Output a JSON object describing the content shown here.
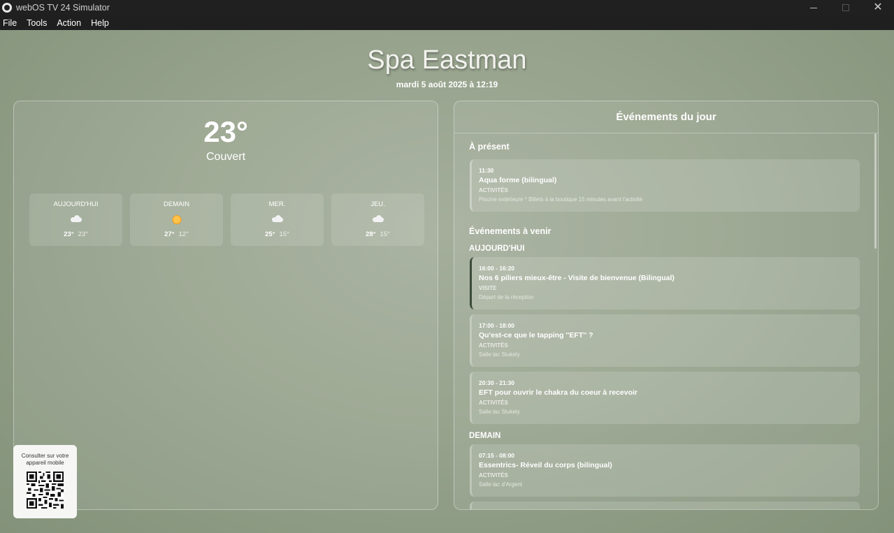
{
  "window": {
    "title": "webOS TV 24 Simulator"
  },
  "menu": [
    "File",
    "Tools",
    "Action",
    "Help"
  ],
  "header": {
    "title": "Spa Eastman",
    "datetime": "mardi 5 août 2025 à 12:19"
  },
  "weather": {
    "current_temp": "23°",
    "condition": "Couvert",
    "forecast": [
      {
        "day": "AUJOURD'HUI",
        "icon": "cloud-icon",
        "high": "23°",
        "low": "23°"
      },
      {
        "day": "DEMAIN",
        "icon": "sun-icon",
        "high": "27°",
        "low": "12°"
      },
      {
        "day": "MER.",
        "icon": "cloud-icon",
        "high": "25°",
        "low": "15°"
      },
      {
        "day": "JEU.",
        "icon": "cloud-icon",
        "high": "28°",
        "low": "15°"
      }
    ]
  },
  "qr": {
    "label": "Consulter sur votre appareil mobile"
  },
  "events": {
    "title": "Événements du jour",
    "now_label": "À présent",
    "now": {
      "time": "11:30",
      "title": "Aqua forme (bilingual)",
      "category": "ACTIVITÉS",
      "location": "Piscine extérieure * Billets à la boutique 15 minutes avant l'activité"
    },
    "upcoming_label": "Événements à venir",
    "groups": [
      {
        "day": "AUJOURD'HUI",
        "items": [
          {
            "time": "16:00 - 16:20",
            "title": "Nos 6 piliers mieux-être - Visite de bienvenue (Bilingual)",
            "category": "VISITE",
            "location": "Départ de la réception"
          },
          {
            "time": "17:00 - 18:00",
            "title": "Qu'est-ce que le tapping ''EFT'' ?",
            "category": "ACTIVITÉS",
            "location": "Salle lac Stukely"
          },
          {
            "time": "20:30 - 21:30",
            "title": "EFT pour ouvrir le chakra du coeur à recevoir",
            "category": "ACTIVITÉS",
            "location": "Salle lac Stukely"
          }
        ]
      },
      {
        "day": "DEMAIN",
        "items": [
          {
            "time": "07:15 - 08:00",
            "title": "Essentrics- Réveil du corps (bilingual)",
            "category": "ACTIVITÉS",
            "location": "Salle lac d'Argent"
          }
        ]
      }
    ]
  }
}
